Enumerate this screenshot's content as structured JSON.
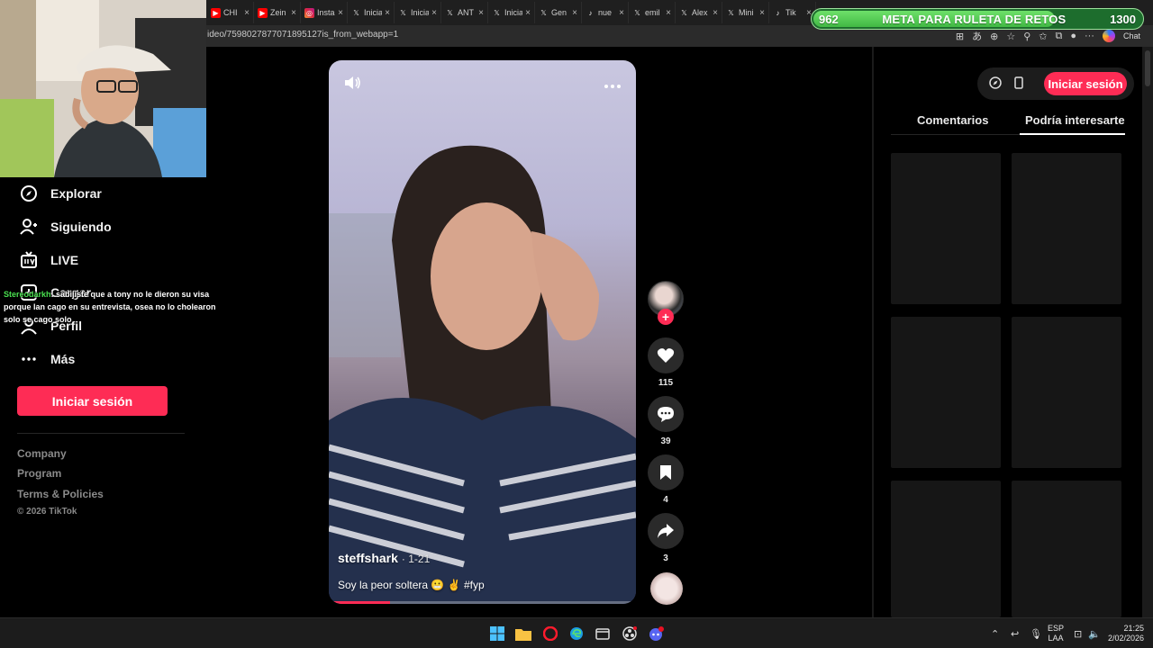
{
  "browser": {
    "tabs": [
      {
        "label": "CHI",
        "icon": "youtube-icon"
      },
      {
        "label": "Zein",
        "icon": "youtube-icon"
      },
      {
        "label": "Insta",
        "icon": "instagram-icon"
      },
      {
        "label": "Inicia",
        "icon": "x-icon"
      },
      {
        "label": "Inicia",
        "icon": "x-icon"
      },
      {
        "label": "ANT",
        "icon": "x-icon"
      },
      {
        "label": "Inicia",
        "icon": "x-icon"
      },
      {
        "label": "Gen",
        "icon": "x-icon"
      },
      {
        "label": "nue",
        "icon": "tiktok-icon"
      },
      {
        "label": "emil",
        "icon": "x-icon"
      },
      {
        "label": "Alex",
        "icon": "x-icon"
      },
      {
        "label": "Mini",
        "icon": "x-icon"
      },
      {
        "label": "Tik",
        "icon": "tiktok-icon"
      }
    ],
    "url": "ideo/7598027877071895127is_from_webapp=1",
    "chat_label": "Chat"
  },
  "goal": {
    "current": "962",
    "title": "META PARA RULETA DE RETOS",
    "target": "1300",
    "progress": 0.74,
    "accent": "#41b944"
  },
  "sidebar": {
    "items": [
      {
        "label": "Explorar",
        "icon": "compass-icon"
      },
      {
        "label": "Siguiendo",
        "icon": "following-icon"
      },
      {
        "label": "LIVE",
        "icon": "live-tv-icon"
      },
      {
        "label": "Cargar",
        "icon": "upload-icon"
      },
      {
        "label": "Perfil",
        "icon": "profile-icon"
      },
      {
        "label": "Más",
        "icon": "more-icon"
      }
    ],
    "login_label": "Iniciar sesión",
    "footer": [
      "Company",
      "Program",
      "Terms & Policies"
    ],
    "copyright": "© 2026 TikTok"
  },
  "stream_chat": {
    "user": "Stereodarkh",
    "message": ": sabijiste que a tony no le dieron su visa porque lan cago en su entrevista, osea no lo cholearon solo se cago solo"
  },
  "video": {
    "author": "steffshark",
    "date": "· 1-21",
    "description": "Soy la peor soltera 😬 ✌️ #fyp",
    "progress": 0.2,
    "likes": "115",
    "comments": "39",
    "saves": "4",
    "shares": "3"
  },
  "right_panel": {
    "login_label": "Iniciar sesión",
    "tabs": [
      "Comentarios",
      "Podría interesarte"
    ],
    "active_tab": 1
  },
  "taskbar": {
    "lang_top": "ESP",
    "lang_bottom": "LAA",
    "time": "21:25",
    "date": "2/02/2026"
  },
  "colors": {
    "brand": "#fe2c55",
    "background": "#000000"
  }
}
